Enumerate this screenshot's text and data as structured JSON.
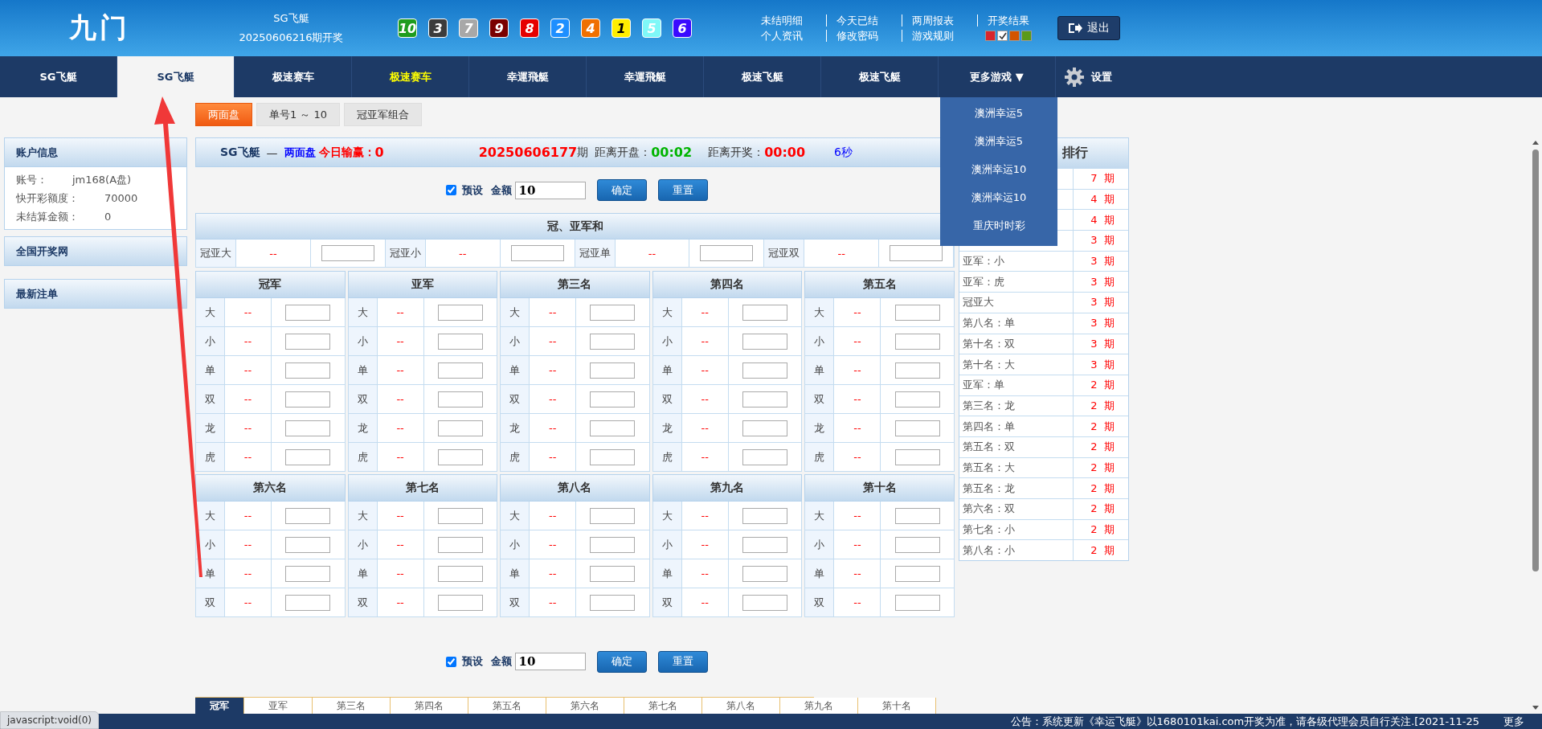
{
  "header": {
    "logo": "九门",
    "game": "SG飞艇",
    "draw": "20250606216期开奖",
    "balls": [
      {
        "number": "10",
        "color": "#1e9c1e"
      },
      {
        "number": "3",
        "color": "#3c3c3c"
      },
      {
        "number": "7",
        "color": "#a8a8a8"
      },
      {
        "number": "9",
        "color": "#7a0000"
      },
      {
        "number": "8",
        "color": "#e60000"
      },
      {
        "number": "2",
        "color": "#1e8fff"
      },
      {
        "number": "4",
        "color": "#f07000"
      },
      {
        "number": "1",
        "color": "#ffee00"
      },
      {
        "number": "5",
        "color": "#7ff8f8"
      },
      {
        "number": "6",
        "color": "#3a0aff"
      }
    ],
    "links": [
      "未结明细",
      "今天已结",
      "两周报表",
      "开奖结果",
      "个人资讯",
      "修改密码",
      "游戏规则"
    ],
    "themes": [
      {
        "color": "#d9262c",
        "selected": false
      },
      {
        "color": "#ffffff",
        "selected": true
      },
      {
        "color": "#d35400",
        "selected": false
      },
      {
        "color": "#5a9a1a",
        "selected": false
      }
    ],
    "logout": "退出"
  },
  "nav": {
    "items": [
      {
        "label": "SG飞艇",
        "selected": false,
        "highlight": false
      },
      {
        "label": "SG飞艇",
        "selected": true,
        "highlight": false
      },
      {
        "label": "极速赛车",
        "selected": false,
        "highlight": false
      },
      {
        "label": "极速赛车",
        "selected": false,
        "highlight": true
      },
      {
        "label": "幸運飛艇",
        "selected": false,
        "highlight": false
      },
      {
        "label": "幸運飛艇",
        "selected": false,
        "highlight": false
      },
      {
        "label": "极速飞艇",
        "selected": false,
        "highlight": false
      },
      {
        "label": "极速飞艇",
        "selected": false,
        "highlight": false
      }
    ],
    "more": "更多游戏 ▼",
    "settings": "设置"
  },
  "dropdown": [
    "澳洲幸运5",
    "澳洲幸运5",
    "澳洲幸运10",
    "澳洲幸运10",
    "重庆时时彩"
  ],
  "sidebar": {
    "account": {
      "title": "账户信息",
      "fields": [
        {
          "label": "账号：",
          "value": "jm168(A盘)"
        },
        {
          "label": "快开彩额度：",
          "value": "70000"
        },
        {
          "label": "未结算金额：",
          "value": "0"
        }
      ]
    },
    "panels": [
      "全国开奖网",
      "最新注单"
    ]
  },
  "play_tabs": [
    {
      "label": "两面盘",
      "selected": true
    },
    {
      "label": "单号1 ～ 10",
      "selected": false
    },
    {
      "label": "冠亚军组合",
      "selected": false
    }
  ],
  "status": {
    "game": "SG飞艇",
    "dash": "—",
    "mode": "两面盘",
    "pnl_label": "今日输赢：",
    "pnl": "0",
    "period": "20250606177",
    "period_suffix": "期",
    "open_label": "距离开盘：",
    "open": "00:02",
    "draw_label": "距离开奖：",
    "draw": "00:00",
    "refresh": "6秒"
  },
  "preset_top": {
    "checked": true,
    "label": "预设",
    "amount_label": "金额",
    "amount": "10",
    "confirm": "确定",
    "reset": "重置"
  },
  "sum": {
    "title": "冠、亚军和",
    "cells": [
      {
        "label": "冠亚大",
        "odds": "--"
      },
      {
        "label": "冠亚小",
        "odds": "--"
      },
      {
        "label": "冠亚单",
        "odds": "--"
      },
      {
        "label": "冠亚双",
        "odds": "--"
      }
    ]
  },
  "groups": [
    {
      "columns": [
        {
          "title": "冠军",
          "rows": [
            {
              "label": "大",
              "odds": "--"
            },
            {
              "label": "小",
              "odds": "--"
            },
            {
              "label": "单",
              "odds": "--"
            },
            {
              "label": "双",
              "odds": "--"
            },
            {
              "label": "龙",
              "odds": "--"
            },
            {
              "label": "虎",
              "odds": "--"
            }
          ]
        },
        {
          "title": "亚军",
          "rows": [
            {
              "label": "大",
              "odds": "--"
            },
            {
              "label": "小",
              "odds": "--"
            },
            {
              "label": "单",
              "odds": "--"
            },
            {
              "label": "双",
              "odds": "--"
            },
            {
              "label": "龙",
              "odds": "--"
            },
            {
              "label": "虎",
              "odds": "--"
            }
          ]
        },
        {
          "title": "第三名",
          "rows": [
            {
              "label": "大",
              "odds": "--"
            },
            {
              "label": "小",
              "odds": "--"
            },
            {
              "label": "单",
              "odds": "--"
            },
            {
              "label": "双",
              "odds": "--"
            },
            {
              "label": "龙",
              "odds": "--"
            },
            {
              "label": "虎",
              "odds": "--"
            }
          ]
        },
        {
          "title": "第四名",
          "rows": [
            {
              "label": "大",
              "odds": "--"
            },
            {
              "label": "小",
              "odds": "--"
            },
            {
              "label": "单",
              "odds": "--"
            },
            {
              "label": "双",
              "odds": "--"
            },
            {
              "label": "龙",
              "odds": "--"
            },
            {
              "label": "虎",
              "odds": "--"
            }
          ]
        },
        {
          "title": "第五名",
          "rows": [
            {
              "label": "大",
              "odds": "--"
            },
            {
              "label": "小",
              "odds": "--"
            },
            {
              "label": "单",
              "odds": "--"
            },
            {
              "label": "双",
              "odds": "--"
            },
            {
              "label": "龙",
              "odds": "--"
            },
            {
              "label": "虎",
              "odds": "--"
            }
          ]
        }
      ]
    },
    {
      "columns": [
        {
          "title": "第六名",
          "rows": [
            {
              "label": "大",
              "odds": "--"
            },
            {
              "label": "小",
              "odds": "--"
            },
            {
              "label": "单",
              "odds": "--"
            },
            {
              "label": "双",
              "odds": "--"
            }
          ]
        },
        {
          "title": "第七名",
          "rows": [
            {
              "label": "大",
              "odds": "--"
            },
            {
              "label": "小",
              "odds": "--"
            },
            {
              "label": "单",
              "odds": "--"
            },
            {
              "label": "双",
              "odds": "--"
            }
          ]
        },
        {
          "title": "第八名",
          "rows": [
            {
              "label": "大",
              "odds": "--"
            },
            {
              "label": "小",
              "odds": "--"
            },
            {
              "label": "单",
              "odds": "--"
            },
            {
              "label": "双",
              "odds": "--"
            }
          ]
        },
        {
          "title": "第九名",
          "rows": [
            {
              "label": "大",
              "odds": "--"
            },
            {
              "label": "小",
              "odds": "--"
            },
            {
              "label": "单",
              "odds": "--"
            },
            {
              "label": "双",
              "odds": "--"
            }
          ]
        },
        {
          "title": "第十名",
          "rows": [
            {
              "label": "大",
              "odds": "--"
            },
            {
              "label": "小",
              "odds": "--"
            },
            {
              "label": "单",
              "odds": "--"
            },
            {
              "label": "双",
              "odds": "--"
            }
          ]
        }
      ]
    }
  ],
  "preset_bottom": {
    "checked": true,
    "label": "预设",
    "amount_label": "金额",
    "amount": "10",
    "confirm": "确定",
    "reset": "重置"
  },
  "ranking": {
    "title": "排行",
    "rows": [
      {
        "count": "7",
        "unit": "期"
      },
      {
        "count": "4",
        "unit": "期"
      },
      {
        "count": "4",
        "unit": "期"
      },
      {
        "count": "3",
        "unit": "期"
      },
      {
        "label": "亚军：小",
        "count": "3",
        "unit": "期"
      },
      {
        "label": "亚军：虎",
        "count": "3",
        "unit": "期"
      },
      {
        "label": "冠亚大",
        "count": "3",
        "unit": "期"
      },
      {
        "label": "第八名：单",
        "count": "3",
        "unit": "期"
      },
      {
        "label": "第十名：双",
        "count": "3",
        "unit": "期"
      },
      {
        "label": "第十名：大",
        "count": "3",
        "unit": "期"
      },
      {
        "label": "亚军：单",
        "count": "2",
        "unit": "期"
      },
      {
        "label": "第三名：龙",
        "count": "2",
        "unit": "期"
      },
      {
        "label": "第四名：单",
        "count": "2",
        "unit": "期"
      },
      {
        "label": "第五名：双",
        "count": "2",
        "unit": "期"
      },
      {
        "label": "第五名：大",
        "count": "2",
        "unit": "期"
      },
      {
        "label": "第五名：龙",
        "count": "2",
        "unit": "期"
      },
      {
        "label": "第六名：双",
        "count": "2",
        "unit": "期"
      },
      {
        "label": "第七名：小",
        "count": "2",
        "unit": "期"
      },
      {
        "label": "第八名：小",
        "count": "2",
        "unit": "期"
      }
    ]
  },
  "rank_tabs": [
    {
      "label": "冠军",
      "selected": true
    },
    {
      "label": "亚军",
      "selected": false
    },
    {
      "label": "第三名",
      "selected": false
    },
    {
      "label": "第四名",
      "selected": false
    },
    {
      "label": "第五名",
      "selected": false
    },
    {
      "label": "第六名",
      "selected": false
    },
    {
      "label": "第七名",
      "selected": false
    },
    {
      "label": "第八名",
      "selected": false
    },
    {
      "label": "第九名",
      "selected": false
    },
    {
      "label": "第十名",
      "selected": false
    }
  ],
  "footer": {
    "notice": "公告：系统更新《幸运飞艇》以1680101kai.com开奖为准，请各级代理会员自行关注.[2021-11-25",
    "more": "更多",
    "status_url": "javascript:void(0)"
  }
}
